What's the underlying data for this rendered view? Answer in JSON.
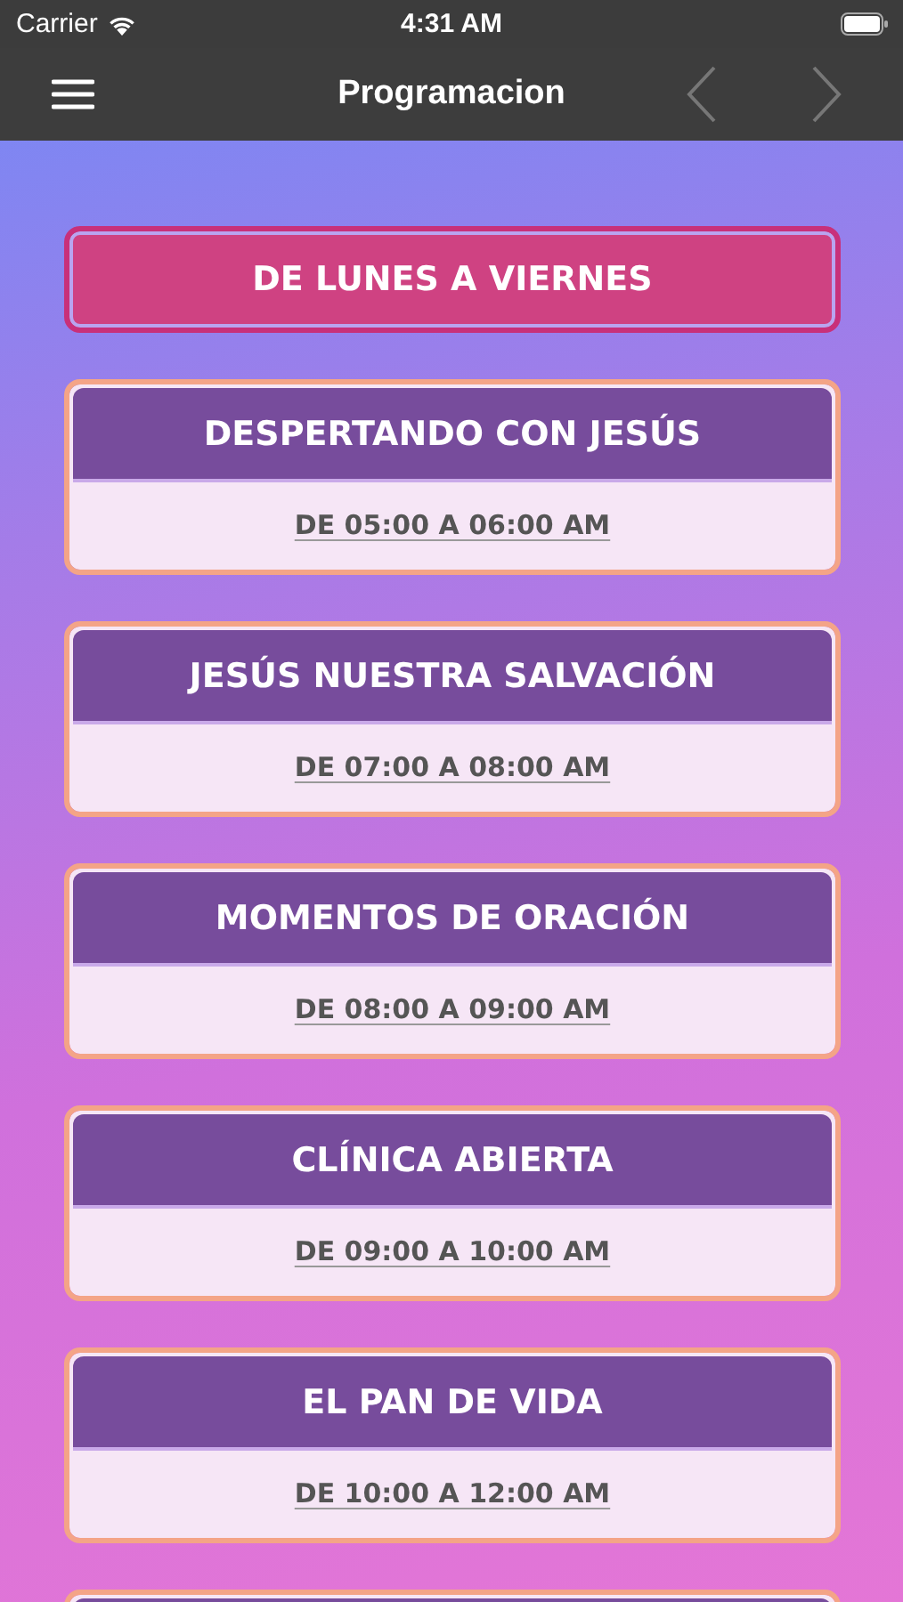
{
  "status_bar": {
    "carrier": "Carrier",
    "time": "4:31 AM"
  },
  "nav_bar": {
    "title": "Programacion"
  },
  "section_button": {
    "label": "DE LUNES A VIERNES"
  },
  "programs": [
    {
      "title": "DESPERTANDO CON JESÚS",
      "time": "DE 05:00 A 06:00 AM"
    },
    {
      "title": "JESÚS NUESTRA SALVACIÓN",
      "time": "DE 07:00 A 08:00 AM"
    },
    {
      "title": "MOMENTOS DE ORACIÓN",
      "time": "DE 08:00 A 09:00 AM"
    },
    {
      "title": "CLÍNICA ABIERTA",
      "time": "DE 09:00 A 10:00 AM"
    },
    {
      "title": "EL PAN DE VIDA",
      "time": "DE 10:00 A 12:00 AM"
    }
  ]
}
